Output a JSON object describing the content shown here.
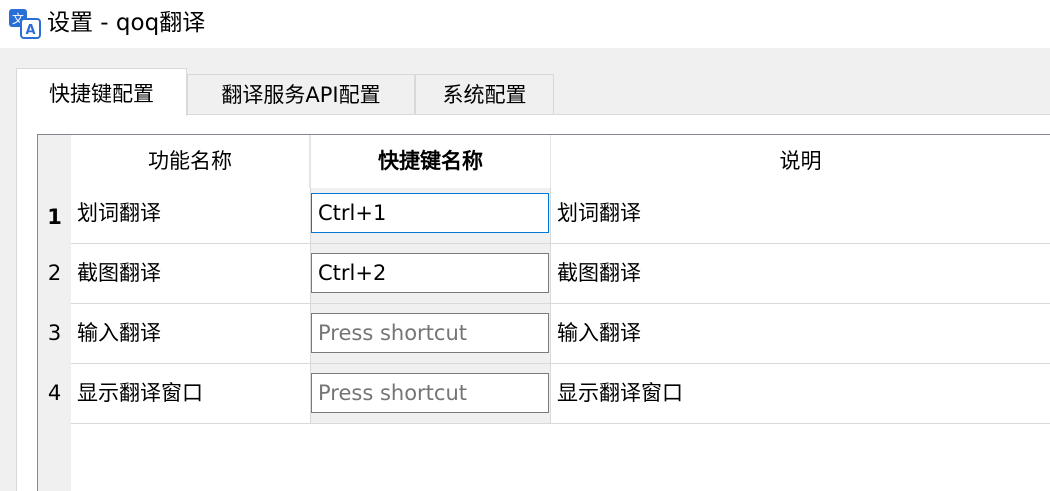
{
  "window": {
    "title": "设置 - qoq翻译",
    "icon": "translate-icon"
  },
  "tabs": [
    {
      "label": "快捷键配置",
      "active": true
    },
    {
      "label": "翻译服务API配置",
      "active": false
    },
    {
      "label": "系统配置",
      "active": false
    }
  ],
  "table": {
    "columns": [
      "功能名称",
      "快捷键名称",
      "说明"
    ],
    "rows": [
      {
        "index": "1",
        "name": "划词翻译",
        "shortcut": "Ctrl+1",
        "placeholder": "",
        "description": "划词翻译"
      },
      {
        "index": "2",
        "name": "截图翻译",
        "shortcut": "Ctrl+2",
        "placeholder": "",
        "description": "截图翻译"
      },
      {
        "index": "3",
        "name": "输入翻译",
        "shortcut": "",
        "placeholder": "Press shortcut",
        "description": "输入翻译"
      },
      {
        "index": "4",
        "name": "显示翻译窗口",
        "shortcut": "",
        "placeholder": "Press shortcut",
        "description": "显示翻译窗口"
      }
    ]
  },
  "colors": {
    "focus_border": "#0078d7",
    "icon_blue": "#2a6fd6"
  }
}
